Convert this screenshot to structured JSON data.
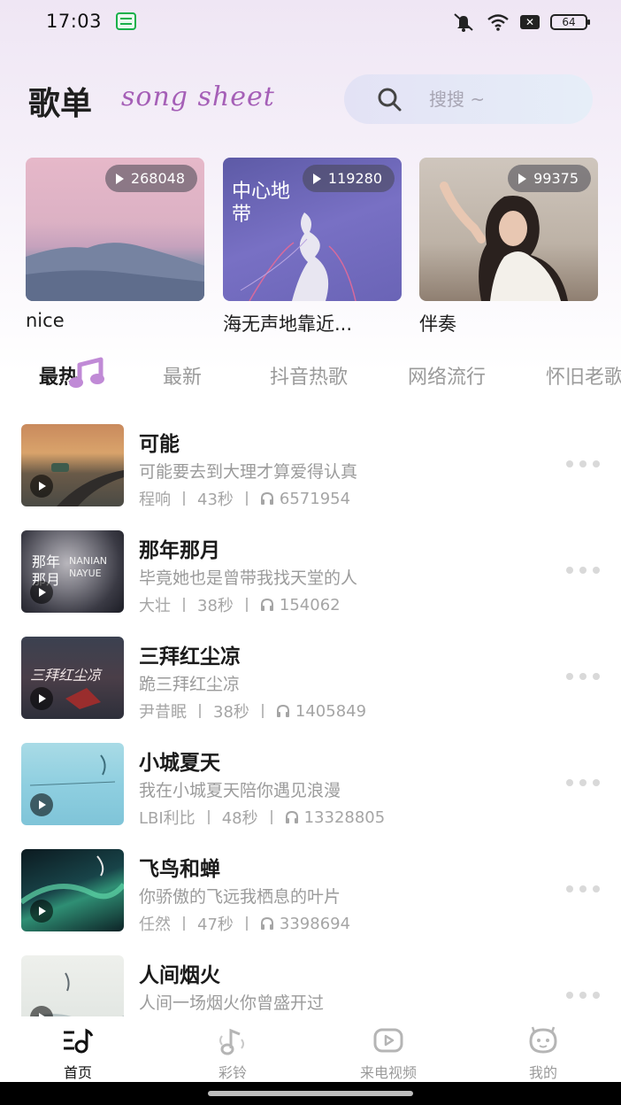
{
  "status_bar": {
    "time": "17:03",
    "battery": "64"
  },
  "header": {
    "title": "歌单",
    "script_title": "song sheet",
    "search_placeholder": "搜搜 ~"
  },
  "featured": [
    {
      "count": "268048",
      "title": "nice"
    },
    {
      "count": "119280",
      "title": "海无声地靠近...",
      "cover_text": "中心地带"
    },
    {
      "count": "99375",
      "title": "伴奏"
    }
  ],
  "tabs": [
    "最热",
    "最新",
    "抖音热歌",
    "网络流行",
    "怀旧老歌"
  ],
  "active_tab": 0,
  "songs": [
    {
      "title": "可能",
      "subtitle": "可能要去到大理才算爱得认真",
      "artist": "程响",
      "duration": "43秒",
      "plays": "6571954"
    },
    {
      "title": "那年那月",
      "subtitle": "毕竟她也是曾带我找天堂的人",
      "artist": "大壮",
      "duration": "38秒",
      "plays": "154062",
      "cover_text": "那年那月",
      "cover_text_en": "NANIAN NAYUE"
    },
    {
      "title": "三拜红尘凉",
      "subtitle": "跪三拜红尘凉",
      "artist": "尹昔眠",
      "duration": "38秒",
      "plays": "1405849",
      "cover_text": "三拜红尘凉"
    },
    {
      "title": "小城夏天",
      "subtitle": "我在小城夏天陪你遇见浪漫",
      "artist": "LBI利比",
      "duration": "48秒",
      "plays": "13328805"
    },
    {
      "title": "飞鸟和蝉",
      "subtitle": "你骄傲的飞远我栖息的叶片",
      "artist": "任然",
      "duration": "47秒",
      "plays": "3398694"
    },
    {
      "title": "人间烟火",
      "subtitle": "人间一场烟火你曾盛开过",
      "artist": "",
      "duration": "",
      "plays": ""
    }
  ],
  "bottom_nav": [
    {
      "label": "首页",
      "icon": "home-music-icon",
      "active": true
    },
    {
      "label": "彩铃",
      "icon": "ringtone-note-icon",
      "active": false
    },
    {
      "label": "来电视频",
      "icon": "video-play-icon",
      "active": false
    },
    {
      "label": "我的",
      "icon": "profile-face-icon",
      "active": false
    }
  ],
  "colors": {
    "accent_purple": "#a55fb7",
    "header_bg": "#efe6f4",
    "search_bg": "#e3e2f5",
    "status_green": "#18b04a"
  }
}
